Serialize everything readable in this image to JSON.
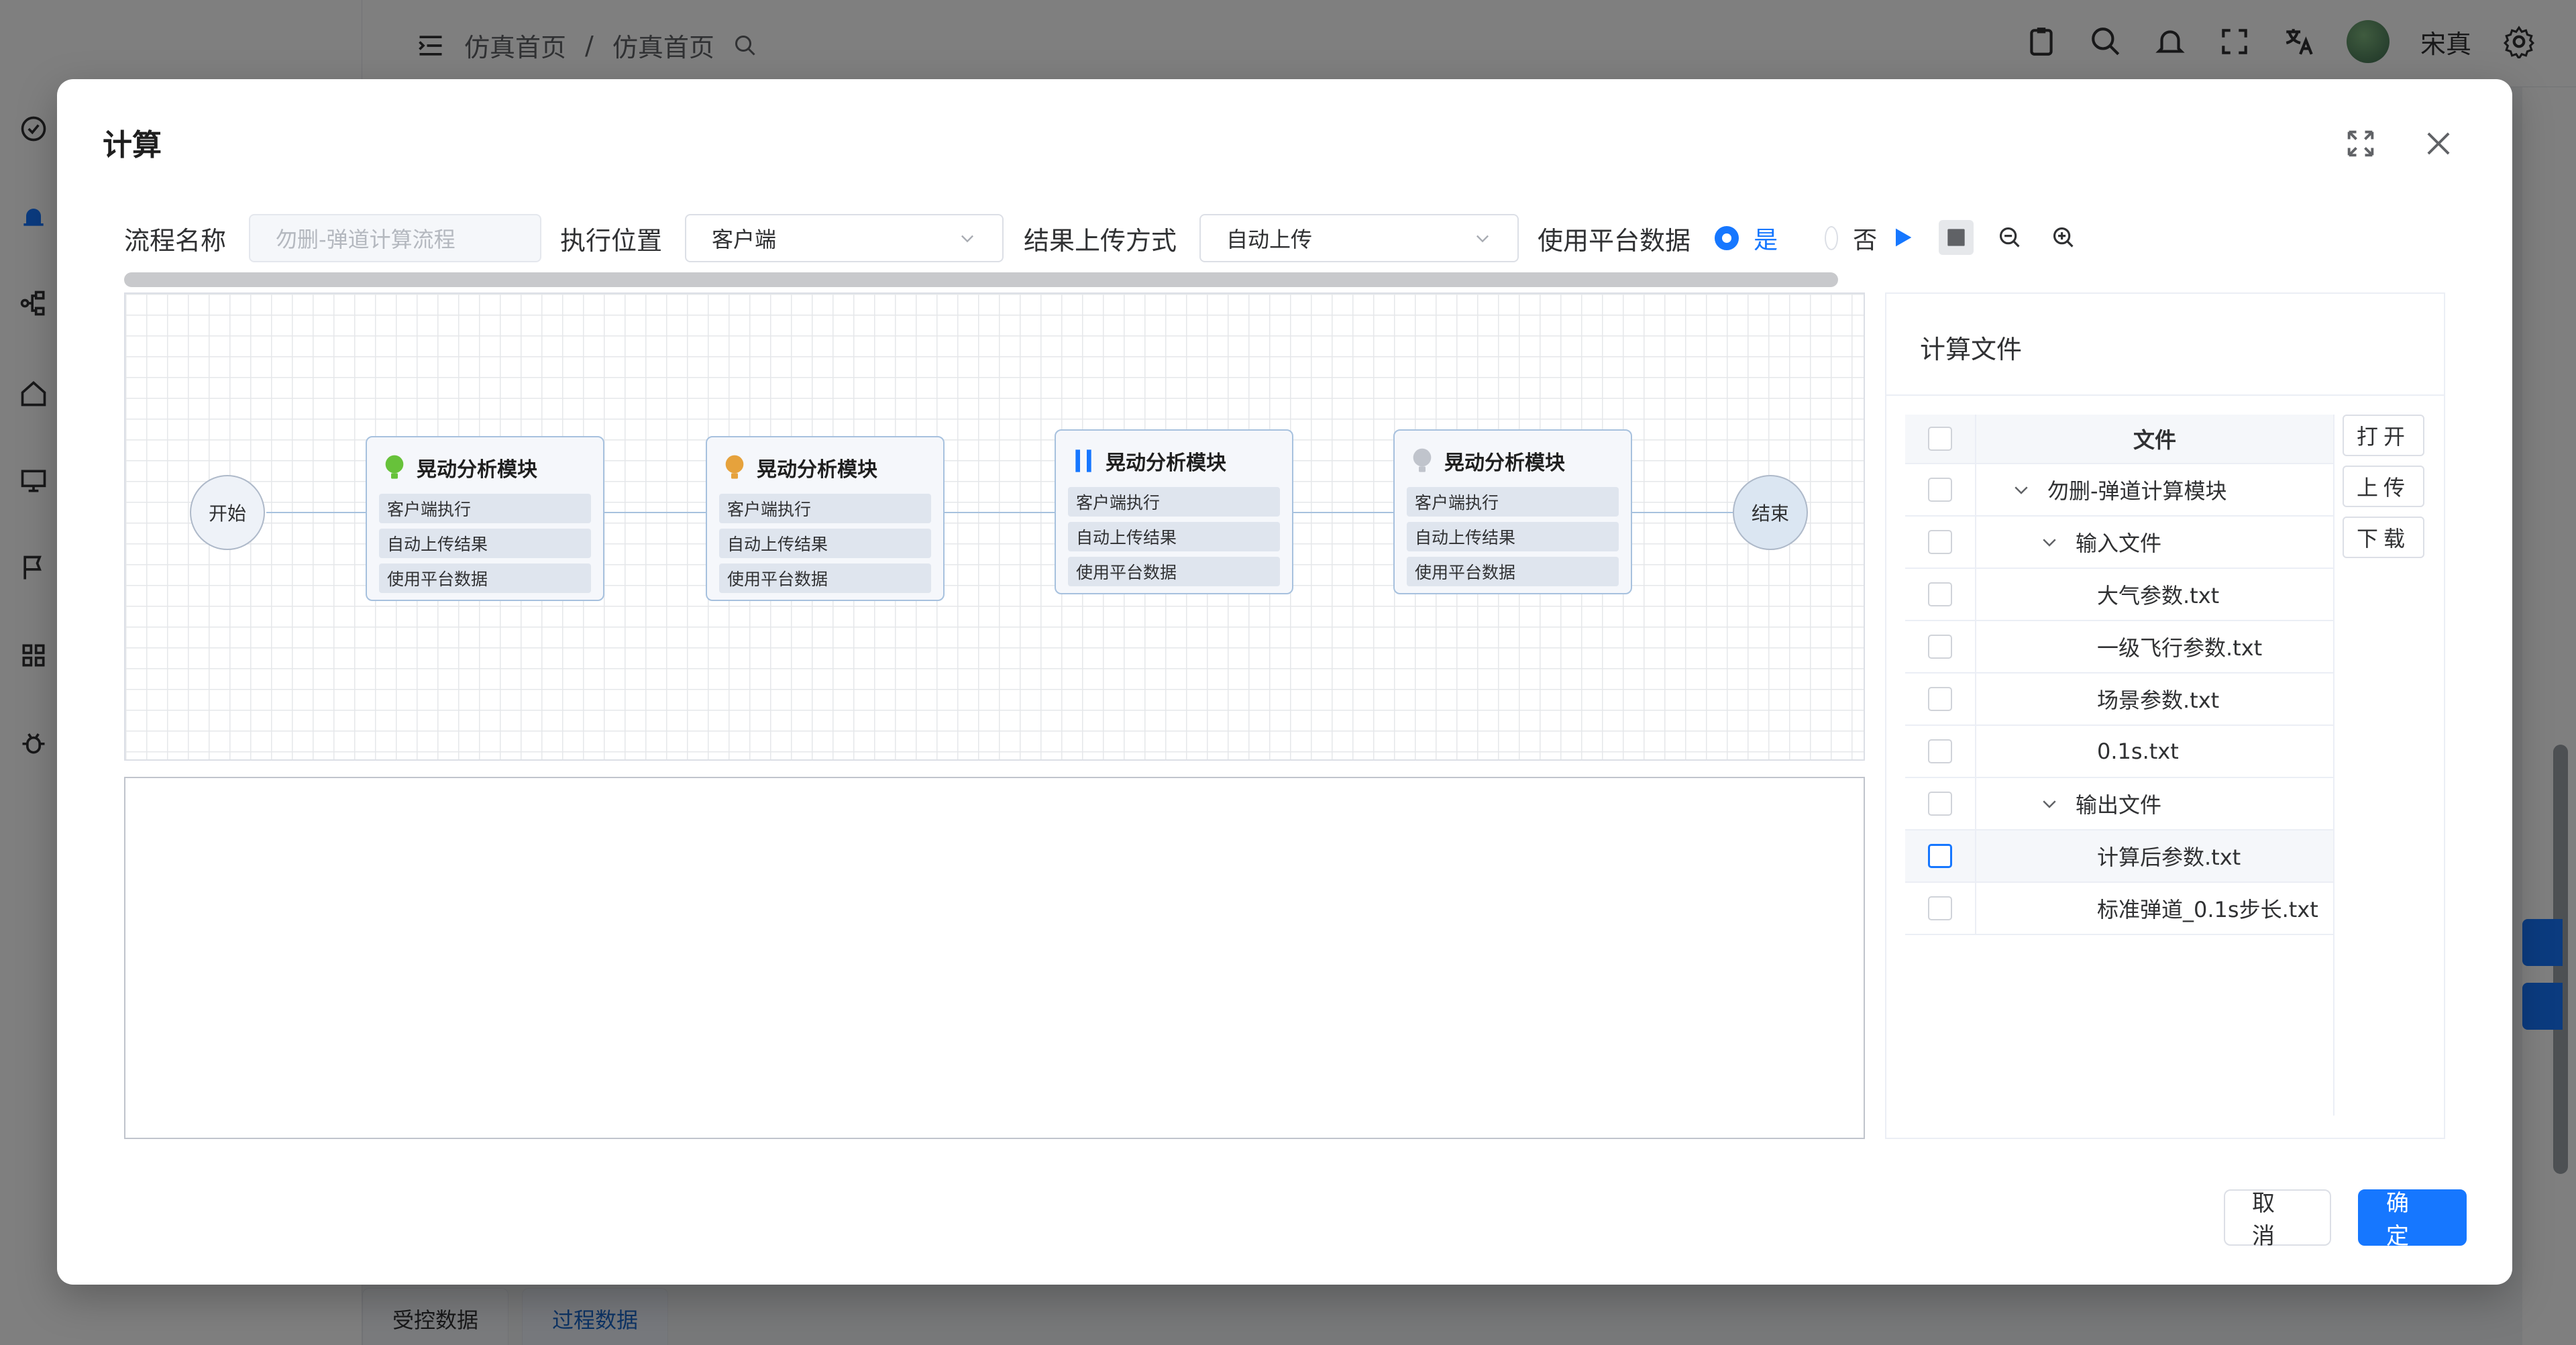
{
  "background": {
    "breadcrumb": [
      "仿真首页",
      "/",
      "仿真首页"
    ],
    "user_name": "宋真",
    "tabs": [
      "受控数据",
      "过程数据"
    ]
  },
  "dialog": {
    "title": "计算",
    "form": {
      "flow_name_label": "流程名称",
      "flow_name_value": "勿删-弹道计算流程",
      "exec_location_label": "执行位置",
      "exec_location_value": "客户端",
      "upload_mode_label": "结果上传方式",
      "upload_mode_value": "自动上传",
      "use_platform_label": "使用平台数据",
      "radio_yes": "是",
      "radio_no": "否"
    },
    "flow": {
      "start_label": "开始",
      "end_label": "结束",
      "nodes": [
        {
          "title": "晃动分析模块",
          "status_icon": "green-bulb-icon",
          "rows": [
            "客户端执行",
            "自动上传结果",
            "使用平台数据"
          ]
        },
        {
          "title": "晃动分析模块",
          "status_icon": "orange-bulb-icon",
          "rows": [
            "客户端执行",
            "自动上传结果",
            "使用平台数据"
          ]
        },
        {
          "title": "晃动分析模块",
          "status_icon": "pause-icon",
          "rows": [
            "客户端执行",
            "自动上传结果",
            "使用平台数据"
          ]
        },
        {
          "title": "晃动分析模块",
          "status_icon": "gray-bulb-icon",
          "rows": [
            "客户端执行",
            "自动上传结果",
            "使用平台数据"
          ]
        }
      ]
    },
    "files": {
      "title": "计算文件",
      "header": "文件",
      "rows": [
        {
          "name": "勿删-弹道计算模块",
          "caret": true
        },
        {
          "name": "输入文件",
          "caret": true
        },
        {
          "name": "大气参数.txt",
          "caret": false
        },
        {
          "name": "一级飞行参数.txt",
          "caret": false
        },
        {
          "name": "场景参数.txt",
          "caret": false
        },
        {
          "name": "0.1s.txt",
          "caret": false
        },
        {
          "name": "输出文件",
          "caret": true
        },
        {
          "name": "计算后参数.txt",
          "caret": false
        },
        {
          "name": "标准弹道_0.1s步长.txt",
          "caret": false
        }
      ],
      "buttons": [
        "打开",
        "上传",
        "下载"
      ]
    },
    "cancel_label": "取消",
    "ok_label": "确定"
  },
  "colors": {
    "primary": "#1677ff",
    "node_border": "#a7c1de",
    "green_status": "#67c23a",
    "orange_status": "#e6a23c",
    "pause_status": "#1677ff",
    "gray_status": "#c0c4cc"
  }
}
